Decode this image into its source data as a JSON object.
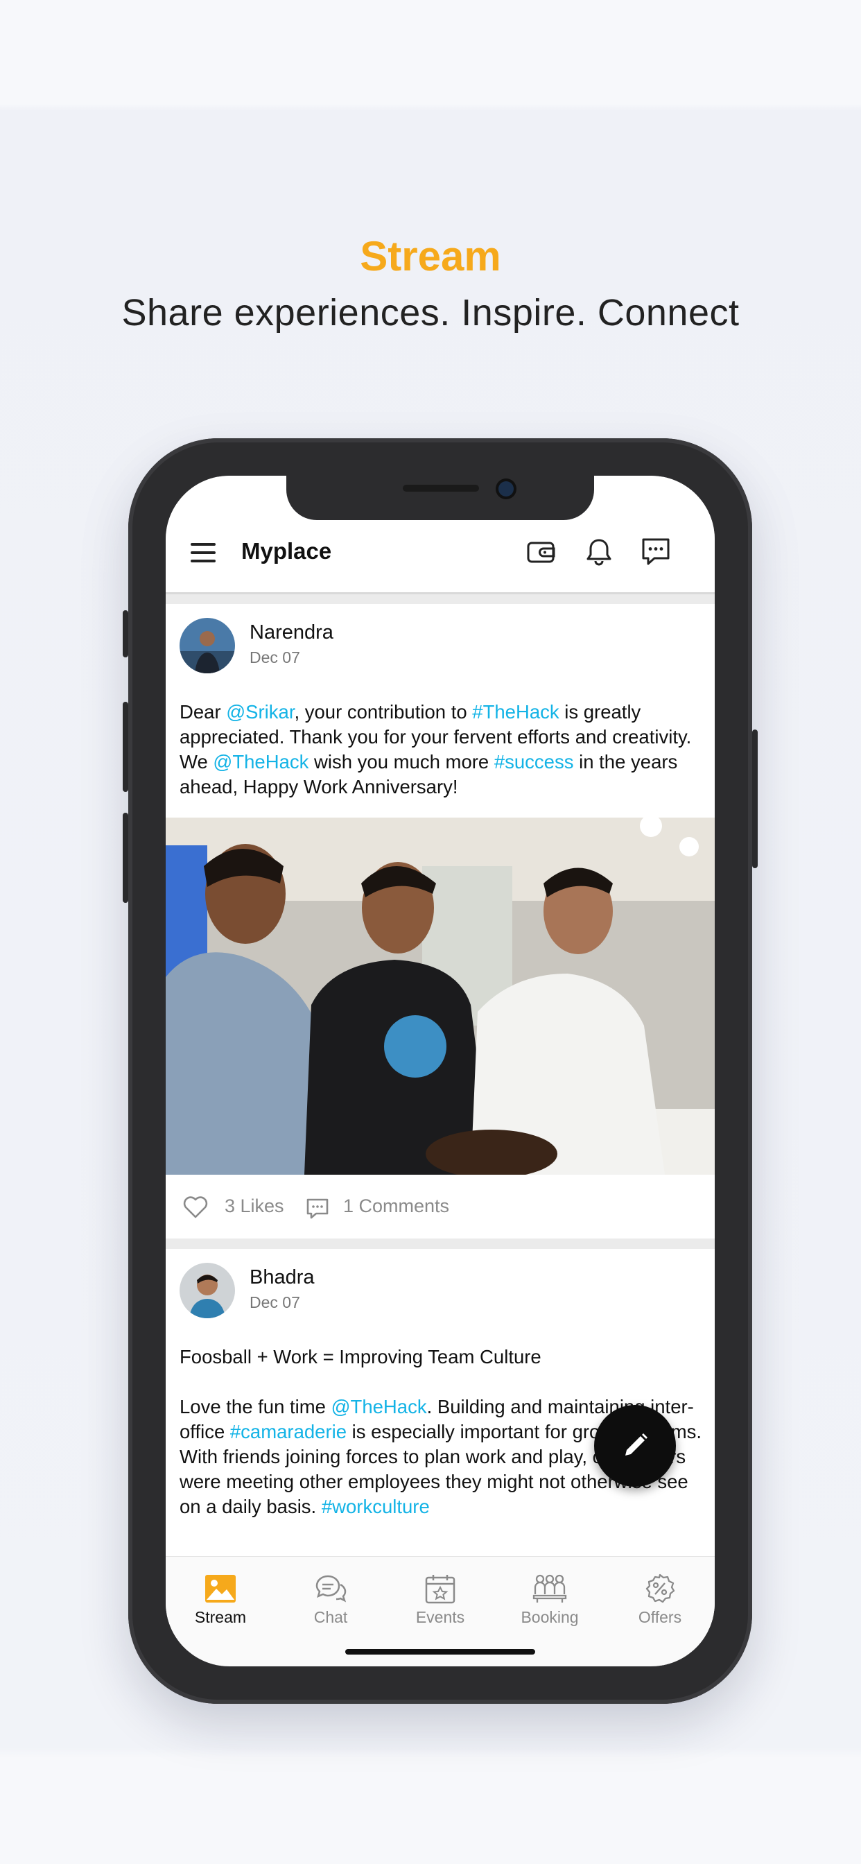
{
  "promo": {
    "title": "Stream",
    "subtitle": "Share experiences. Inspire. Connect"
  },
  "app": {
    "title": "Myplace",
    "header_icons": [
      "wallet-icon",
      "bell-icon",
      "chat-bubble-icon"
    ]
  },
  "colors": {
    "accent": "#f6a91b",
    "hashtag": "#13b3e6",
    "fab": "#0d0d0d"
  },
  "posts": [
    {
      "author": "Narendra",
      "date": "Dec 07",
      "text_segments": [
        {
          "t": "Dear "
        },
        {
          "t": "@Srikar",
          "link": true
        },
        {
          "t": ", your contribution to "
        },
        {
          "t": "#TheHack",
          "link": true
        },
        {
          "t": " is greatly appreciated. Thank you for your fervent efforts and creativity. We "
        },
        {
          "t": "@TheHack",
          "link": true
        },
        {
          "t": " wish you much more "
        },
        {
          "t": "#success",
          "link": true
        },
        {
          "t": " in the years ahead, Happy Work Anniversary!"
        }
      ],
      "likes": "3 Likes",
      "comments": "1 Comments"
    },
    {
      "author": "Bhadra",
      "date": "Dec 07",
      "text_segments": [
        {
          "t": "Foosball + Work = Improving Team Culture\n\nLove the fun time "
        },
        {
          "t": "@TheHack",
          "link": true
        },
        {
          "t": ". Building and maintaining inter-office "
        },
        {
          "t": "#camaraderie",
          "link": true
        },
        {
          "t": " is especially important for growing teams. With friends joining forces to plan work and play, co-workers were meeting other employees they might not otherwise see on a daily basis. "
        },
        {
          "t": "#workculture",
          "link": true
        }
      ]
    }
  ],
  "nav": {
    "items": [
      {
        "label": "Stream",
        "icon": "image-icon",
        "active": true
      },
      {
        "label": "Chat",
        "icon": "chat-icon",
        "active": false
      },
      {
        "label": "Events",
        "icon": "calendar-icon",
        "active": false
      },
      {
        "label": "Booking",
        "icon": "people-icon",
        "active": false
      },
      {
        "label": "Offers",
        "icon": "discount-icon",
        "active": false
      }
    ]
  }
}
